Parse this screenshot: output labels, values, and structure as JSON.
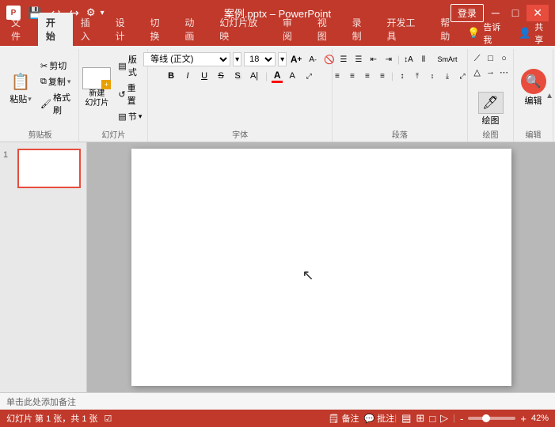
{
  "titlebar": {
    "app_name": "PowerPoint",
    "file_name": "案例.pptx",
    "separator": "–",
    "login_label": "登录",
    "window_controls": {
      "minimize": "─",
      "maximize": "□",
      "close": "✕"
    }
  },
  "ribbon": {
    "tabs": [
      {
        "id": "file",
        "label": "文件"
      },
      {
        "id": "home",
        "label": "开始",
        "active": true
      },
      {
        "id": "insert",
        "label": "插入"
      },
      {
        "id": "design",
        "label": "设计"
      },
      {
        "id": "transitions",
        "label": "切换"
      },
      {
        "id": "animations",
        "label": "动画"
      },
      {
        "id": "slideshow",
        "label": "幻灯片放映"
      },
      {
        "id": "review",
        "label": "审阅"
      },
      {
        "id": "view",
        "label": "视图"
      },
      {
        "id": "record",
        "label": "录制"
      },
      {
        "id": "devtools",
        "label": "开发工具"
      },
      {
        "id": "help",
        "label": "帮助"
      }
    ],
    "right_items": [
      {
        "id": "lightbulb",
        "label": "告诉我"
      },
      {
        "id": "share",
        "label": "共享"
      }
    ],
    "groups": {
      "clipboard": {
        "label": "剪贴板",
        "paste": "粘贴",
        "cut": "✂",
        "copy": "⧉",
        "format_painter": "🖌"
      },
      "slides": {
        "label": "幻灯片",
        "new_slide": "新建\n幻灯片",
        "layout": "□",
        "reset": "↺",
        "section": "▤"
      },
      "font": {
        "label": "字体",
        "font_name": "等线 (正文)",
        "font_size": "18",
        "bold": "B",
        "italic": "I",
        "underline": "U",
        "strikethrough": "S",
        "shadow": "S",
        "char_spacing": "A",
        "increase_size": "A↑",
        "decrease_size": "A↓",
        "clear_format": "A",
        "font_color": "A",
        "text_highlight": "A"
      },
      "paragraph": {
        "label": "段落",
        "bullets": "≡",
        "numbering": "≡",
        "indent_less": "←≡",
        "indent_more": "→≡",
        "align_left": "≡",
        "align_center": "≡",
        "align_right": "≡",
        "justify": "≡",
        "columns": "⫴",
        "line_spacing": "↕",
        "direction": "A",
        "smart_art": "SmartArt"
      },
      "drawing": {
        "label": "绘图",
        "icon": "△",
        "button_label": "绘图"
      },
      "editing": {
        "label": "编辑",
        "icon": "🔍",
        "button_label": "编辑"
      }
    }
  },
  "slides": [
    {
      "number": "1",
      "is_active": true
    }
  ],
  "canvas": {
    "notes_placeholder": "单击此处添加备注"
  },
  "statusbar": {
    "slide_info": "幻灯片 第 1 张，共 1 张",
    "spell_check": "☑",
    "notes": "备注",
    "comments": "批注",
    "normal_view": "▤",
    "slide_sorter": "⊞",
    "reading_view": "□",
    "slideshow": "▷",
    "zoom_percent": "42%",
    "zoom_plus": "+",
    "zoom_minus": "-"
  }
}
